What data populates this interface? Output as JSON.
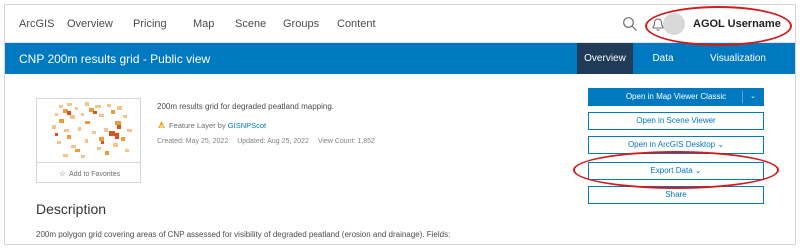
{
  "nav": {
    "links": [
      "ArcGIS",
      "Overview",
      "Pricing",
      "Map",
      "Scene",
      "Groups",
      "Content"
    ],
    "username": "AGOL Username",
    "search_icon": "search-icon",
    "bell_icon": "bell-icon"
  },
  "item": {
    "title": "CNP 200m results grid - Public view",
    "tabs": [
      "Overview",
      "Data",
      "Visualization"
    ],
    "active_tab": "Overview",
    "summary": "200m results grid for degraded peatland mapping.",
    "type_label": "Feature Layer by",
    "owner": "GISNPScot",
    "created": "Created: May 25, 2022",
    "updated": "Updated: Aug 25, 2022",
    "view_count": "View Count: 1,852",
    "favorites_label": "Add to Favorites"
  },
  "actions": {
    "open_map_viewer": "Open in Map Viewer Classic",
    "open_scene_viewer": "Open in Scene Viewer",
    "open_desktop": "Open in ArcGIS Desktop",
    "export_data": "Export Data",
    "share": "Share"
  },
  "description": {
    "heading": "Description",
    "text": "200m polygon grid covering areas of CNP assessed for visibility of degraded peatland (erosion and drainage). Fields:"
  },
  "colors": {
    "brand_blue": "#0079c1",
    "active_tab": "#1f3b57",
    "annotation_red": "#d01c1c"
  }
}
